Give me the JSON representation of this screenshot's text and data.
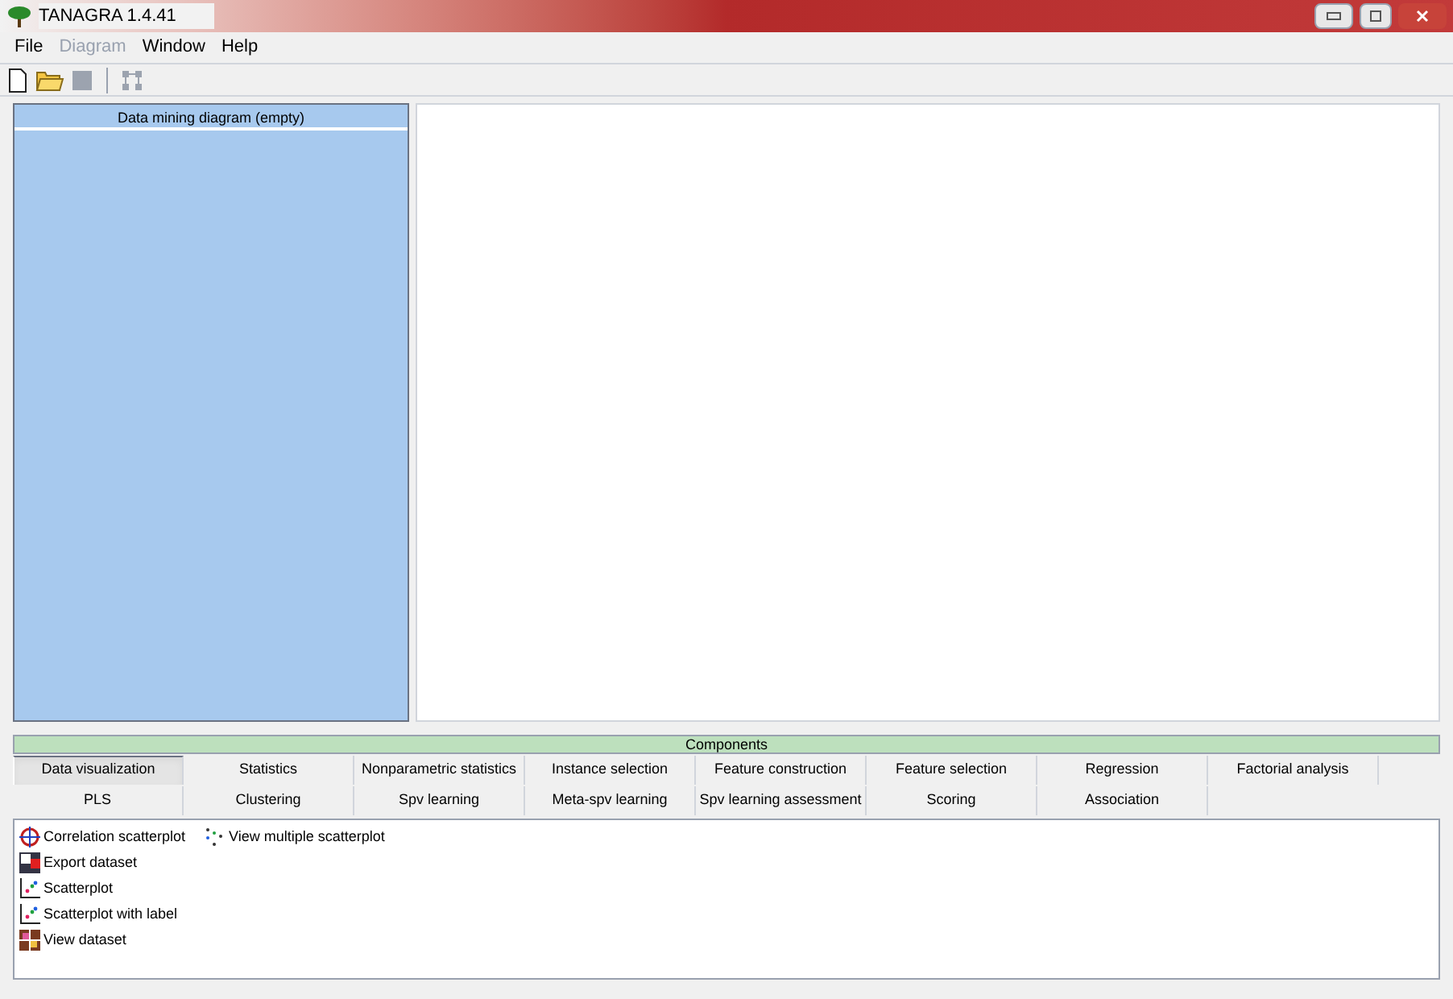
{
  "window": {
    "title": "TANAGRA 1.4.41"
  },
  "menu": [
    {
      "label": "File",
      "disabled": false
    },
    {
      "label": "Diagram",
      "disabled": true
    },
    {
      "label": "Window",
      "disabled": false
    },
    {
      "label": "Help",
      "disabled": false
    }
  ],
  "toolbar": [
    {
      "kind": "new",
      "disabled": false
    },
    {
      "kind": "open"
    },
    {
      "kind": "save",
      "disabled": true
    },
    {
      "kind": "separator"
    },
    {
      "kind": "layout",
      "disabled": true
    }
  ],
  "diagram": {
    "title": "Data mining diagram (empty)"
  },
  "components": {
    "title": "Components",
    "tabs": [
      [
        {
          "label": "Data visualization",
          "selected": true
        },
        {
          "label": "Statistics",
          "selected": false
        },
        {
          "label": "Nonparametric statistics",
          "selected": false
        },
        {
          "label": "Instance selection",
          "selected": false
        },
        {
          "label": "Feature construction",
          "selected": false
        },
        {
          "label": "Feature selection",
          "selected": false
        },
        {
          "label": "Regression",
          "selected": false
        },
        {
          "label": "Factorial analysis",
          "selected": false
        }
      ],
      [
        {
          "label": "PLS",
          "selected": false
        },
        {
          "label": "Clustering",
          "selected": false
        },
        {
          "label": "Spv learning",
          "selected": false
        },
        {
          "label": "Meta-spv learning",
          "selected": false
        },
        {
          "label": "Spv learning assessment",
          "selected": false
        },
        {
          "label": "Scoring",
          "selected": false
        },
        {
          "label": "Association",
          "selected": false
        }
      ]
    ],
    "items": [
      [
        {
          "label": "Correlation scatterplot",
          "kind": "crosshair"
        },
        {
          "label": "Export dataset",
          "kind": "export"
        },
        {
          "label": "Scatterplot",
          "kind": "scatter"
        },
        {
          "label": "Scatterplot with label",
          "kind": "scatter"
        },
        {
          "label": "View dataset",
          "kind": "grid"
        }
      ],
      [
        {
          "label": "View multiple scatterplot",
          "kind": "multi"
        }
      ]
    ]
  }
}
